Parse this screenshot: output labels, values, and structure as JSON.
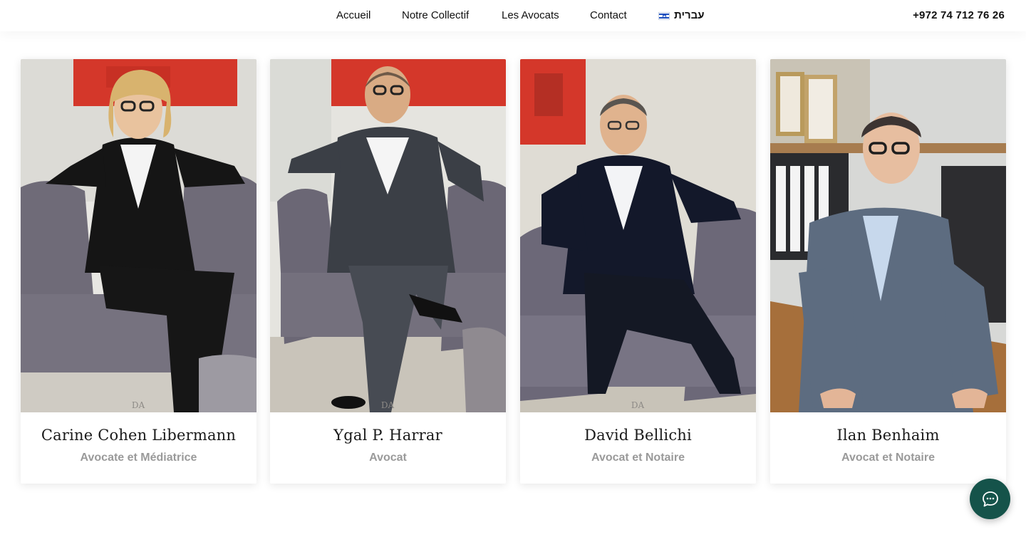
{
  "nav": {
    "items": [
      "Accueil",
      "Notre Collectif",
      "Les Avocats",
      "Contact"
    ],
    "language": "עברית",
    "language_flag_icon": "israel-flag-icon"
  },
  "phone": "+972 74 712 76 26",
  "lawyers": [
    {
      "name": "Carine Cohen Libermann",
      "title": "Avocate et Médiatrice",
      "photo_watermark": "DA"
    },
    {
      "name": "Ygal P. Harrar",
      "title": "Avocat",
      "photo_watermark": "DA"
    },
    {
      "name": "David Bellichi",
      "title": "Avocat et Notaire",
      "photo_watermark": "DA"
    },
    {
      "name": "Ilan Benhaim",
      "title": "Avocat et Notaire",
      "photo_watermark": ""
    }
  ],
  "chat": {
    "icon": "chat-bubble-icon",
    "color": "#15534a"
  },
  "colors": {
    "subtitle": "#9a9a9a",
    "accent": "#15534a",
    "painting_red": "#d4372a"
  }
}
